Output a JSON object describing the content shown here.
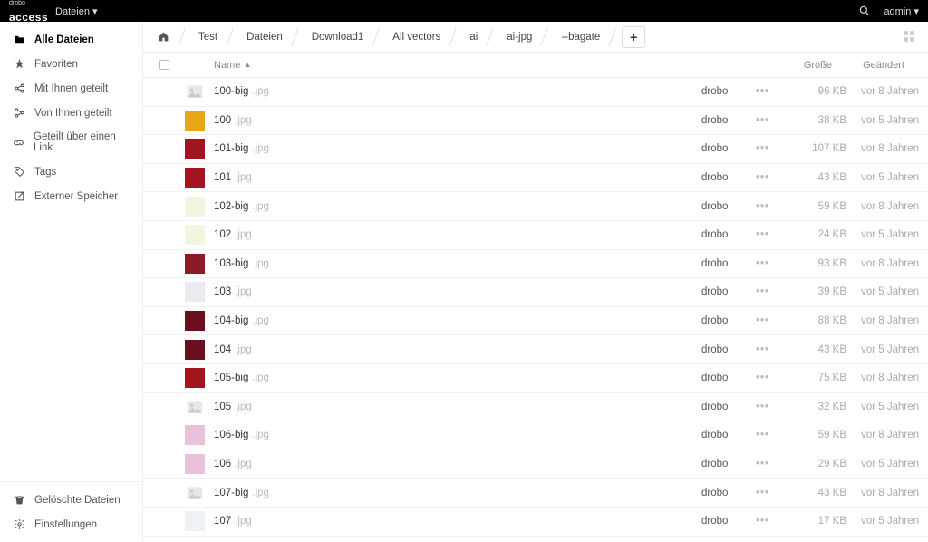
{
  "topbar": {
    "brand_sub": "drobo",
    "brand_logo": "access",
    "app_menu": "Dateien",
    "user": "admin"
  },
  "sidebar": {
    "items": [
      {
        "icon": "folder",
        "label": "Alle Dateien",
        "active": true
      },
      {
        "icon": "star",
        "label": "Favoriten"
      },
      {
        "icon": "share-in",
        "label": "Mit Ihnen geteilt"
      },
      {
        "icon": "share-out",
        "label": "Von Ihnen geteilt"
      },
      {
        "icon": "link",
        "label": "Geteilt über einen Link"
      },
      {
        "icon": "tag",
        "label": "Tags"
      },
      {
        "icon": "external",
        "label": "Externer Speicher"
      }
    ],
    "footer": [
      {
        "icon": "trash",
        "label": "Gelöschte Dateien"
      },
      {
        "icon": "gear",
        "label": "Einstellungen"
      }
    ]
  },
  "breadcrumbs": [
    "Test",
    "Dateien",
    "Download1",
    "All vectors",
    "ai",
    "ai-jpg",
    "--bagate"
  ],
  "columns": {
    "name": "Name",
    "size": "Größe",
    "date": "Geändert"
  },
  "owner": "drobo",
  "files": [
    {
      "base": "100-big",
      "ext": ".jpg",
      "size": "96 KB",
      "date": "vor 8 Jahren",
      "thumb": "placeholder"
    },
    {
      "base": "100",
      "ext": ".jpg",
      "size": "38 KB",
      "date": "vor 5 Jahren",
      "thumb": "#e3a814"
    },
    {
      "base": "101-big",
      "ext": ".jpg",
      "size": "107 KB",
      "date": "vor 8 Jahren",
      "thumb": "#a11420"
    },
    {
      "base": "101",
      "ext": ".jpg",
      "size": "43 KB",
      "date": "vor 5 Jahren",
      "thumb": "#a11420"
    },
    {
      "base": "102-big",
      "ext": ".jpg",
      "size": "59 KB",
      "date": "vor 8 Jahren",
      "thumb": "#f2f5e0"
    },
    {
      "base": "102",
      "ext": ".jpg",
      "size": "24 KB",
      "date": "vor 5 Jahren",
      "thumb": "#f2f5e0"
    },
    {
      "base": "103-big",
      "ext": ".jpg",
      "size": "93 KB",
      "date": "vor 8 Jahren",
      "thumb": "#8a1a24"
    },
    {
      "base": "103",
      "ext": ".jpg",
      "size": "39 KB",
      "date": "vor 5 Jahren",
      "thumb": "#eaeaf0"
    },
    {
      "base": "104-big",
      "ext": ".jpg",
      "size": "88 KB",
      "date": "vor 8 Jahren",
      "thumb": "#6a0f1d"
    },
    {
      "base": "104",
      "ext": ".jpg",
      "size": "43 KB",
      "date": "vor 5 Jahren",
      "thumb": "#6a0f1d"
    },
    {
      "base": "105-big",
      "ext": ".jpg",
      "size": "75 KB",
      "date": "vor 8 Jahren",
      "thumb": "#a1151c"
    },
    {
      "base": "105",
      "ext": ".jpg",
      "size": "32 KB",
      "date": "vor 5 Jahren",
      "thumb": "placeholder"
    },
    {
      "base": "106-big",
      "ext": ".jpg",
      "size": "59 KB",
      "date": "vor 8 Jahren",
      "thumb": "#e9c1da"
    },
    {
      "base": "106",
      "ext": ".jpg",
      "size": "29 KB",
      "date": "vor 5 Jahren",
      "thumb": "#e9c1da"
    },
    {
      "base": "107-big",
      "ext": ".jpg",
      "size": "43 KB",
      "date": "vor 8 Jahren",
      "thumb": "placeholder"
    },
    {
      "base": "107",
      "ext": ".jpg",
      "size": "17 KB",
      "date": "vor 5 Jahren",
      "thumb": "#eef2f5"
    }
  ]
}
